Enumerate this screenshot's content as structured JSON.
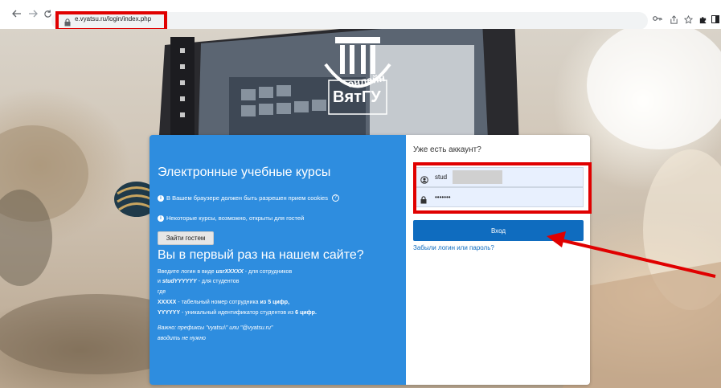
{
  "browser": {
    "url": "e.vyatsu.ru/login/index.php",
    "back_icon": "arrow-left-icon",
    "forward_icon": "arrow-right-icon",
    "reload_icon": "reload-icon",
    "toolbar_icons": [
      "key-icon",
      "share-icon",
      "star-icon",
      "extensions-icon",
      "sidebar-icon",
      "profile-icon"
    ]
  },
  "logo": {
    "line1": "онлайн",
    "line2": "ВятГУ"
  },
  "login_card": {
    "left": {
      "title": "Электронные учебные курсы",
      "notice_cookies": "В Вашем браузере должен быть разрешен прием cookies",
      "notice_guests": "Некоторые курсы, возможно, открыты для гостей",
      "guest_button": "Зайти гостем",
      "first_time_heading": "Вы в первый раз на нашем сайте?",
      "info": {
        "line1_prefix": "Введите логин в виде ",
        "line1_code": "usrXXXXX",
        "line1_suffix": " - для сотрудников",
        "line2_prefix": " и ",
        "line2_code": "studYYYYYY",
        "line2_suffix": " - для студентов",
        "line3": "где",
        "line4_code": "XXXXX",
        "line4_text": " - табельный номер сотрудника ",
        "line4_bold": "из 5 цифр,",
        "line5_code": "YYYYYY",
        "line5_text": " - уникальный идентификатор студентов из ",
        "line5_bold": "6 цифр.",
        "line6": "Важно: префиксы \"vyatsu\\\" или \"@vyatsu.ru\"",
        "line7": "вводить не нужно"
      }
    },
    "right": {
      "have_account": "Уже есть аккаунт?",
      "username_value": "stud",
      "password_value": "•••••••",
      "login_button": "Вход",
      "forgot_link": "Забыли логин или пароль?"
    }
  },
  "colors": {
    "left_panel": "#2e8ddf",
    "login_button": "#0f6cbf",
    "annotation_red": "#e00000"
  }
}
